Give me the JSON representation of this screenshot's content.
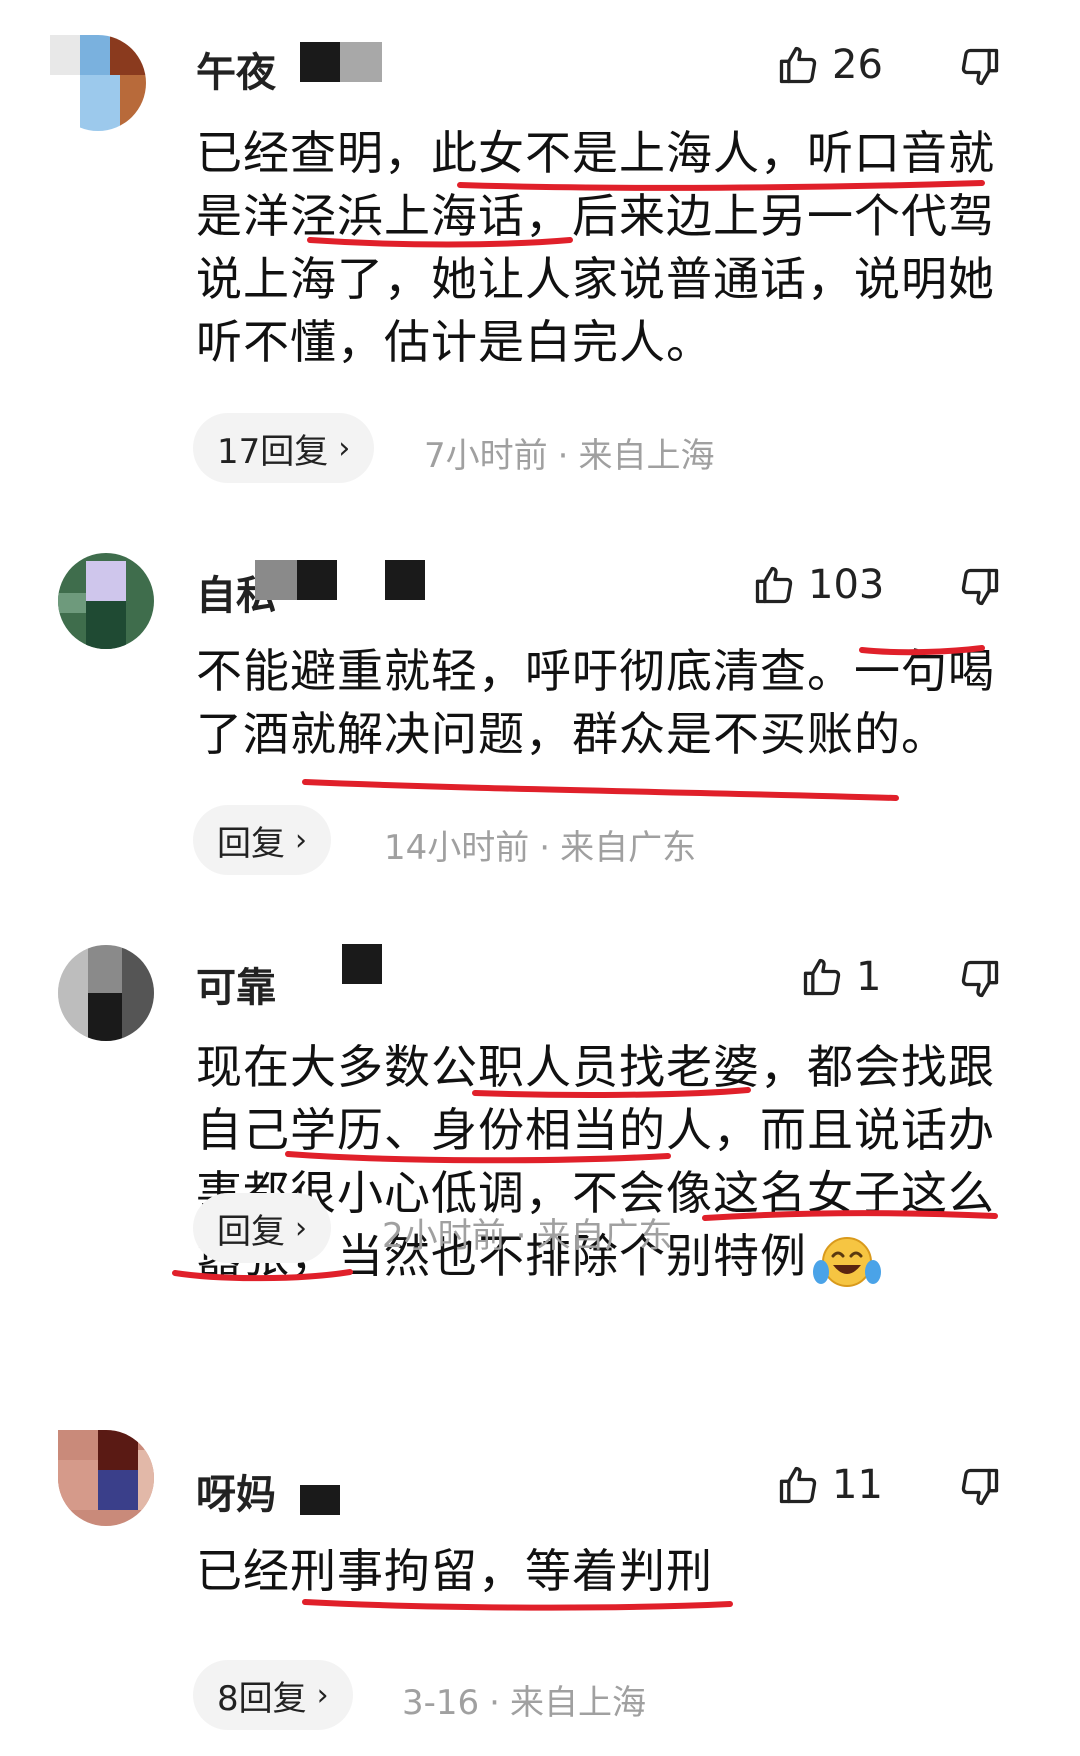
{
  "comments": [
    {
      "username": "午夜",
      "likes": "26",
      "text": "已经查明，此女不是上海人，听口音就是洋泾浜上海话，后来边上另一个代驾说上海了，她让人家说普通话，说明她听不懂，估计是白完人。",
      "reply_label": "17回复",
      "time": "7小时前",
      "location": "来自上海"
    },
    {
      "username": "自私",
      "likes": "103",
      "text": "不能避重就轻，呼吁彻底清查。一句喝了酒就解决问题，群众是不买账的。",
      "reply_label": "回复",
      "time": "14小时前",
      "location": "来自广东"
    },
    {
      "username": "可靠",
      "likes": "1",
      "text": "现在大多数公职人员找老婆，都会找跟自己学历、身份相当的人，而且说话办事都很小心低调，不会像这名女子这么嚣张，当然也不排除个别特例",
      "reply_label": "回复",
      "time": "2小时前",
      "location": "来自广东"
    },
    {
      "username": "呀妈",
      "likes": "11",
      "text": "已经刑事拘留，等着判刑",
      "reply_label": "8回复",
      "time": "3-16",
      "location": "来自上海"
    }
  ],
  "meta_separator": "·",
  "reply_chevron": "›",
  "icons": {
    "like": "thumbs-up-outline",
    "dislike": "thumbs-down-outline",
    "emoji": "tears-of-joy"
  },
  "colors": {
    "underline": "#e0202a",
    "meta_text": "#a0a0a0",
    "pill_bg": "#f3f3f3"
  }
}
